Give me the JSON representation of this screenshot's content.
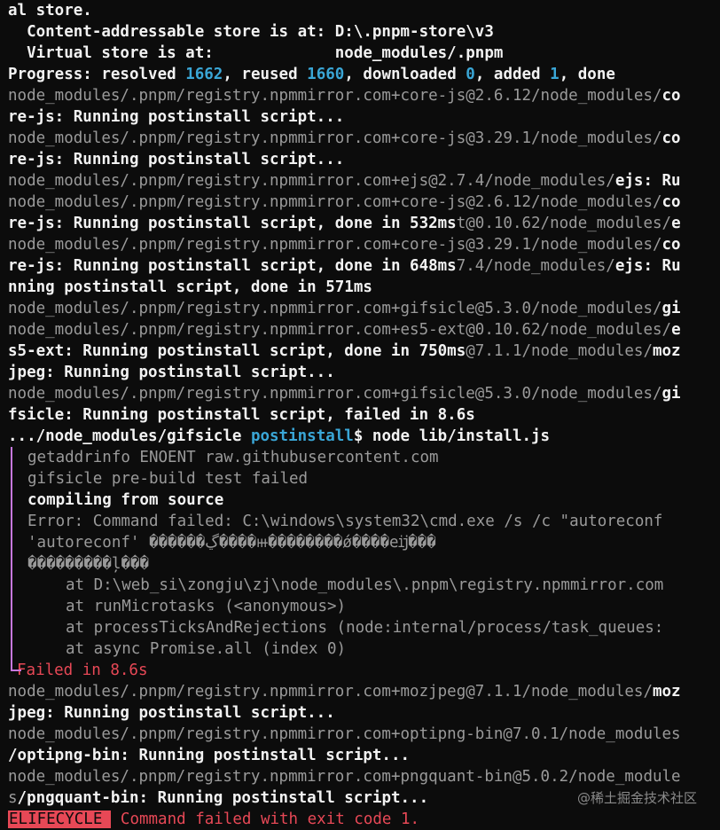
{
  "header": {
    "l1": "al store.",
    "l2": "  Content-addressable store is at: D:\\.pnpm-store\\v3",
    "l3": "  Virtual store is at:             node_modules/.pnpm"
  },
  "progress": {
    "label": "Progress: resolved ",
    "resolved": "1662",
    "reused_label": ", reused ",
    "reused": "1660",
    "downloaded_label": ", downloaded ",
    "downloaded": "0",
    "added_label": ", added ",
    "added": "1",
    "done": ", done"
  },
  "log": [
    {
      "dim": "node_modules/.pnpm/registry.npmmirror.com+core-js@2.6.12/node_modules/",
      "bold": "co"
    },
    {
      "dim": "",
      "bold": "re-js: Running postinstall script..."
    },
    {
      "dim": "node_modules/.pnpm/registry.npmmirror.com+core-js@3.29.1/node_modules/",
      "bold": "co"
    },
    {
      "dim": "",
      "bold": "re-js: Running postinstall script..."
    },
    {
      "dim": "node_modules/.pnpm/registry.npmmirror.com+ejs@2.7.4/node_modules/",
      "bold": "ejs: Ru"
    },
    {
      "dim": "node_modules/.pnpm/registry.npmmirror.com+core-js@2.6.12/node_modules/",
      "bold": "co"
    },
    {
      "bold": "re-js: Running postinstall script, done in 532ms",
      "dim": "t@0.10.62/node_modules/",
      "bold2": "e"
    },
    {
      "dim": "node_modules/.pnpm/registry.npmmirror.com+core-js@3.29.1/node_modules/",
      "bold": "co"
    },
    {
      "bold": "re-js: Running postinstall script, done in 648ms",
      "dim": "7.4/node_modules/",
      "bold2": "ejs: Ru"
    },
    {
      "dim": "",
      "bold": "nning postinstall script, done in 571ms"
    },
    {
      "dim": "node_modules/.pnpm/registry.npmmirror.com+gifsicle@5.3.0/node_modules/",
      "bold": "gi"
    },
    {
      "dim": "node_modules/.pnpm/registry.npmmirror.com+es5-ext@0.10.62/node_modules/",
      "bold": "e"
    },
    {
      "bold": "s5-ext: Running postinstall script, done in 750ms",
      "dim": "@7.1.1/node_modules/",
      "bold2": "moz"
    },
    {
      "dim": "",
      "bold": "jpeg: Running postinstall script..."
    },
    {
      "dim": "node_modules/.pnpm/registry.npmmirror.com+gifsicle@5.3.0/node_modules/",
      "bold": "gi"
    },
    {
      "dim": "",
      "bold": "fsicle: Running postinstall script, failed in 8.6s"
    }
  ],
  "script_line": {
    "prefix": ".../node_modules/gifsicle ",
    "hook": "postinstall",
    "command": "$ node lib/install.js"
  },
  "box": {
    "lines": [
      {
        "text": "getaddrinfo ENOENT raw.githubusercontent.com",
        "style": "dim"
      },
      {
        "text": "gifsicle pre-build test failed",
        "style": "dim"
      },
      {
        "text": "compiling from source",
        "style": "b"
      },
      {
        "text": "Error: Command failed: C:\\windows\\system32\\cmd.exe /s /c \"autoreconf",
        "style": "dim"
      },
      {
        "text": "'autoreconf' ������ڲ����ⲿ��������ǿ����еĳ���",
        "style": "dim"
      },
      {
        "text": "���������ļ���",
        "style": "dim"
      }
    ],
    "stack": [
      "at D:\\web_si\\zongju\\zj\\node_modules\\.pnpm\\registry.npmmirror.com",
      "at runMicrotasks (<anonymous>)",
      "at processTicksAndRejections (node:internal/process/task_queues:",
      "at async Promise.all (index 0)"
    ],
    "failed": "Failed in 8.6s"
  },
  "tail": [
    {
      "dim": "node_modules/.pnpm/registry.npmmirror.com+mozjpeg@7.1.1/node_modules/",
      "bold": "moz"
    },
    {
      "dim": "",
      "bold": "jpeg: Running postinstall script..."
    },
    {
      "dim": "node_modules/.pnpm/registry.npmmirror.com+optipng-bin@7.0.1/node_modules",
      "bold": ""
    },
    {
      "dim": "",
      "bold": "/optipng-bin: Running postinstall script..."
    },
    {
      "dim": "node_modules/.pnpm/registry.npmmirror.com+pngquant-bin@5.0.2/node_module",
      "bold": ""
    },
    {
      "dim": "s",
      "bold": "/pngquant-bin: Running postinstall script..."
    }
  ],
  "footer": {
    "badge": "ELIFECYCLE",
    "message": "Command failed with exit code 1."
  },
  "watermark": "@稀土掘金技术社区",
  "colors": {
    "accent_cyan": "#3aa6d6",
    "error_red": "#e74856",
    "rail_purple": "#c678dd"
  }
}
